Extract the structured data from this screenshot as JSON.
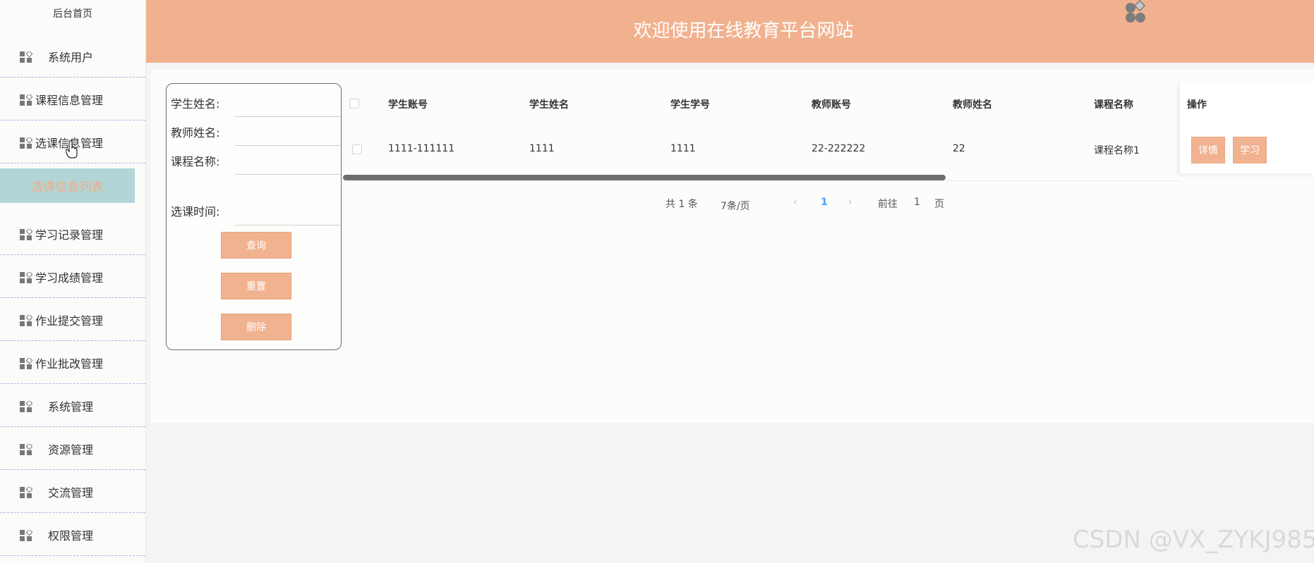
{
  "sidebar": {
    "top_label": "后台首页",
    "items": [
      {
        "label": "系统用户"
      },
      {
        "label": "课程信息管理"
      },
      {
        "label": "选课信息管理"
      },
      {
        "label": "学习记录管理"
      },
      {
        "label": "学习成绩管理"
      },
      {
        "label": "作业提交管理"
      },
      {
        "label": "作业批改管理"
      },
      {
        "label": "系统管理"
      },
      {
        "label": "资源管理"
      },
      {
        "label": "交流管理"
      },
      {
        "label": "权限管理"
      }
    ],
    "active_subitem": "选课信息列表"
  },
  "header": {
    "title": "欢迎使用在线教育平台网站"
  },
  "search": {
    "fields": {
      "student_name": "学生姓名:",
      "teacher_name": "教师姓名:",
      "course_name": "课程名称:",
      "select_time": "选课时间:"
    },
    "buttons": {
      "query": "查询",
      "reset": "重置",
      "delete": "删除"
    }
  },
  "table": {
    "headers": [
      "学生账号",
      "学生姓名",
      "学生学号",
      "教师账号",
      "教师姓名",
      "课程名称",
      "操作"
    ],
    "rows": [
      {
        "student_account": "1111-111111",
        "student_name": "1111",
        "student_no": "1111",
        "teacher_account": "22-222222",
        "teacher_name": "22",
        "course_name": "课程名称1"
      }
    ],
    "actions": {
      "detail": "详情",
      "study": "学习"
    }
  },
  "pagination": {
    "total": "共 1 条",
    "page_size": "7条/页",
    "current_page": "1",
    "goto_label": "前往",
    "goto_value": "1",
    "page_suffix": "页"
  },
  "watermark": "CSDN @VX_ZYKJ985",
  "colors": {
    "accent": "#f1b18f",
    "submenu_bg": "#b2d6d7",
    "submenu_text": "#f2ab86",
    "page_link": "#409eff"
  }
}
